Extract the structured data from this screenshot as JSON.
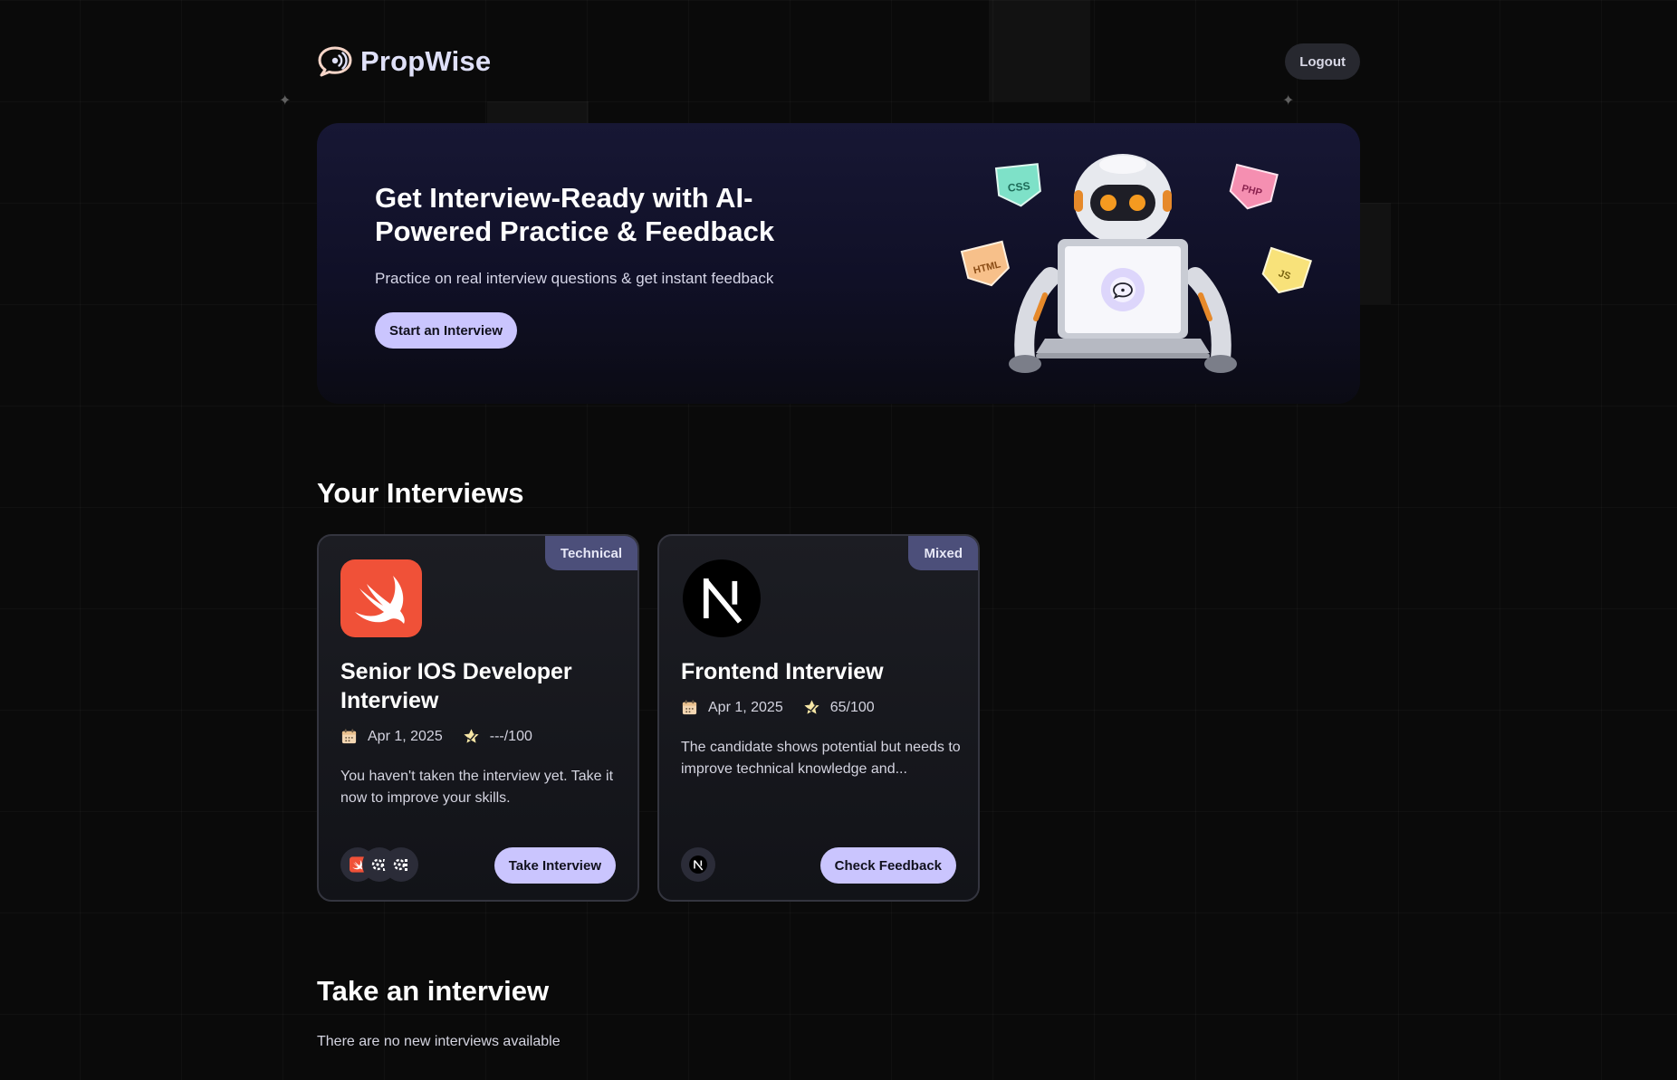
{
  "app": {
    "brand_name": "PropWise"
  },
  "nav": {
    "logout_label": "Logout"
  },
  "hero": {
    "title": "Get Interview-Ready with AI-Powered Practice & Feedback",
    "subtitle": "Practice on real interview questions & get instant feedback",
    "cta_label": "Start an Interview",
    "badges": [
      "CSS",
      "PHP",
      "HTML",
      "JS"
    ]
  },
  "your_interviews": {
    "title": "Your Interviews",
    "cards": [
      {
        "badge": "Technical",
        "cover_icon": "swift-logo-icon",
        "title": "Senior IOS Developer Interview",
        "date": "Apr 1, 2025",
        "score": "---/100",
        "description": "You haven't taken the interview yet. Take it now to improve your skills.",
        "tech_icons": [
          "swift-icon",
          "generic-tech-icon",
          "generic-tech-icon"
        ],
        "action_label": "Take Interview"
      },
      {
        "badge": "Mixed",
        "cover_icon": "nextjs-logo-icon",
        "title": "Frontend Interview",
        "date": "Apr 1, 2025",
        "score": "65/100",
        "description": "The candidate shows potential but needs to improve technical knowledge and...",
        "tech_icons": [
          "nextjs-icon"
        ],
        "action_label": "Check Feedback"
      }
    ]
  },
  "take_interview": {
    "title": "Take an interview",
    "empty_message": "There are no new interviews available"
  },
  "colors": {
    "background": "#0a0a0a",
    "primary_button": "#cac5fe",
    "badge": "#4c4f7a",
    "swift_orange": "#f05138"
  }
}
